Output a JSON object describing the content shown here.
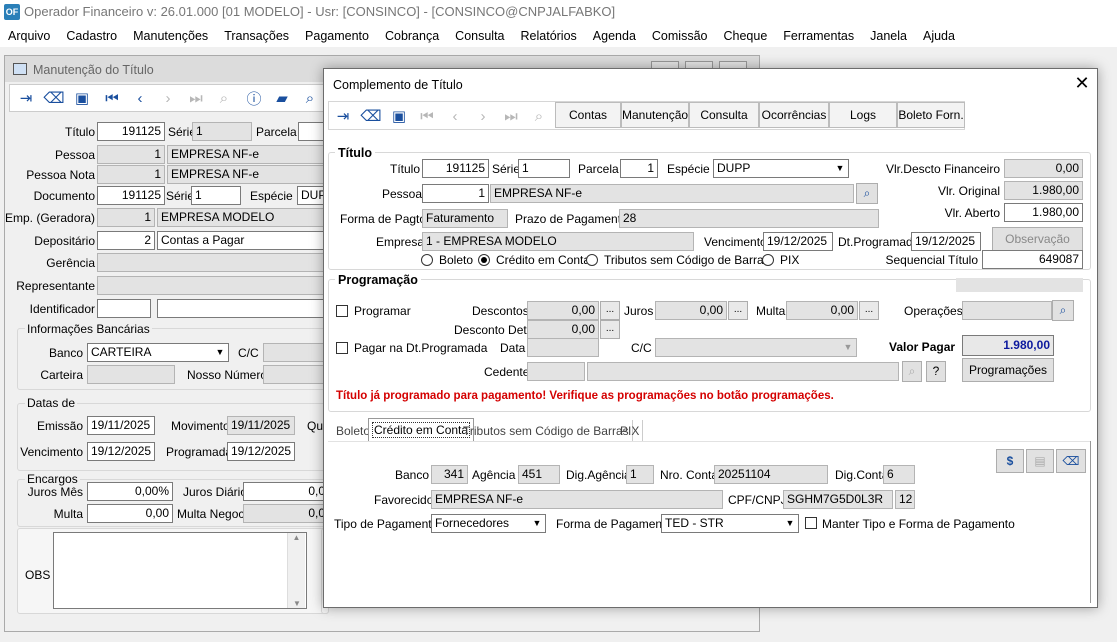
{
  "app": {
    "title": "Operador Financeiro  v: 26.01.000  [01 MODELO] - Usr: [CONSINCO] - [CONSINCO@CNPJALFABKO]",
    "icon": "app-logo-icon"
  },
  "menu": [
    "Arquivo",
    "Cadastro",
    "Manutenções",
    "Transações",
    "Pagamento",
    "Cobrança",
    "Consulta",
    "Relatórios",
    "Agenda",
    "Comissão",
    "Cheque",
    "Ferramentas",
    "Janela",
    "Ajuda"
  ],
  "bg": {
    "title": "Manutenção do Título",
    "labels": {
      "titulo": "Título",
      "serie": "Série",
      "parcela": "Parcela",
      "pessoa": "Pessoa",
      "pessoa_nota": "Pessoa Nota",
      "documento": "Documento",
      "especie": "Espécie",
      "emp": "Emp. (Geradora)",
      "depositario": "Depositário",
      "gerencia": "Gerência",
      "representante": "Representante",
      "identificador": "Identificador",
      "info_banc": "Informações Bancárias",
      "banco": "Banco",
      "cc": "C/C",
      "carteira": "Carteira",
      "nosso_numero": "Nosso Número",
      "datas": "Datas de",
      "emissao": "Emissão",
      "movimento": "Movimento",
      "qui": "Qui",
      "vencimento": "Vencimento",
      "programada": "Programada",
      "encargos": "Encargos",
      "juros_mes": "Juros Mês",
      "juros_diario": "Juros Diário",
      "multa": "Multa",
      "multa_negoc": "Multa Negoc",
      "obs": "OBS"
    },
    "values": {
      "titulo": "191125",
      "serie": "1",
      "pessoa_cod": "1",
      "pessoa_nome": "EMPRESA NF-e",
      "pessoa_nota_cod": "1",
      "pessoa_nota_nome": "EMPRESA NF-e",
      "documento": "191125",
      "doc_serie": "1",
      "especie": "DUP",
      "emp_cod": "1",
      "emp_nome": "EMPRESA MODELO",
      "dep_cod": "2",
      "dep_nome": "Contas a Pagar",
      "banco": "CARTEIRA",
      "emissao": "19/11/2025",
      "movimento": "19/11/2025",
      "vencimento": "19/12/2025",
      "programada": "19/12/2025",
      "juros_mes": "0,00%",
      "juros_diario": "0,0",
      "multa": "0,00",
      "multa_negoc": "0,0"
    }
  },
  "dialog": {
    "title": "Complemento de Título",
    "toolbar": [
      "Contas",
      "Manutenção",
      "Consulta",
      "Ocorrências",
      "Logs",
      "Boleto Forn."
    ],
    "titulo_group": "Título",
    "labels": {
      "titulo": "Título",
      "serie": "Série",
      "parcela": "Parcela",
      "especie": "Espécie",
      "pessoa": "Pessoa",
      "forma_pagto": "Forma de Pagto.",
      "prazo": "Prazo de Pagamento",
      "empresa": "Empresa",
      "vencimento": "Vencimento",
      "dt_programada": "Dt.Programada",
      "vlr_descto": "Vlr.Descto Financeiro",
      "vlr_original": "Vlr. Original",
      "vlr_aberto": "Vlr. Aberto",
      "sequencial": "Sequencial Título"
    },
    "values": {
      "titulo": "191125",
      "serie": "1",
      "parcela": "1",
      "especie": "DUPP",
      "pessoa_cod": "1",
      "pessoa_nome": "EMPRESA NF-e",
      "forma_pagto": "Faturamento",
      "prazo": "28",
      "empresa": "1 - EMPRESA MODELO",
      "vencimento": "19/12/2025",
      "dt_programada": "19/12/2025",
      "vlr_descto": "0,00",
      "vlr_original": "1.980,00",
      "vlr_aberto": "1.980,00",
      "sequencial": "649087"
    },
    "observacao_btn": "Observação",
    "radios": {
      "boleto": "Boleto",
      "credito": "Crédito em Conta",
      "tributos": "Tributos sem Código de Barras",
      "pix": "PIX",
      "selected": "credito"
    },
    "programacao": {
      "title": "Programação",
      "programar": "Programar",
      "pagar_dt": "Pagar na Dt.Programada",
      "descontos": "Descontos",
      "descontos_val": "0,00",
      "juros": "Juros",
      "juros_val": "0,00",
      "multa": "Multa",
      "multa_val": "0,00",
      "operacoes": "Operações",
      "desconto_det": "Desconto Det.",
      "desconto_det_val": "0,00",
      "data": "Data",
      "cc": "C/C",
      "valor_pagar": "Valor Pagar",
      "valor_pagar_val": "1.980,00",
      "cedente": "Cedente",
      "help": "?",
      "programacoes_btn": "Programações",
      "dots": "...",
      "warning": "Título já programado para pagamento! Verifique as programações no botão programações."
    },
    "tabs": [
      "Boleto",
      "Crédito em Conta",
      "Tributos sem Código de Barras",
      "PIX"
    ],
    "credito": {
      "banco_l": "Banco",
      "banco": "341",
      "agencia_l": "Agência",
      "agencia": "451",
      "dig_ag_l": "Dig.Agência",
      "dig_ag": "1",
      "nro_conta_l": "Nro. Conta",
      "nro_conta": "20251104",
      "dig_conta_l": "Dig.Conta",
      "dig_conta": "6",
      "favorecido_l": "Favorecido",
      "favorecido": "EMPRESA NF-e",
      "cpf_l": "CPF/CNPJ",
      "cpf": "SGHM7G5D0L3R",
      "cpf2": "12",
      "tipo_l": "Tipo de Pagamento",
      "tipo": "Fornecedores",
      "forma_l": "Forma de Pagamento",
      "forma": "TED - STR",
      "manter": "Manter Tipo e Forma de Pagamento"
    }
  },
  "colors": {
    "warning": "#d40000",
    "valor_pagar": "#0d1a9e",
    "accent": "#0078d7"
  }
}
